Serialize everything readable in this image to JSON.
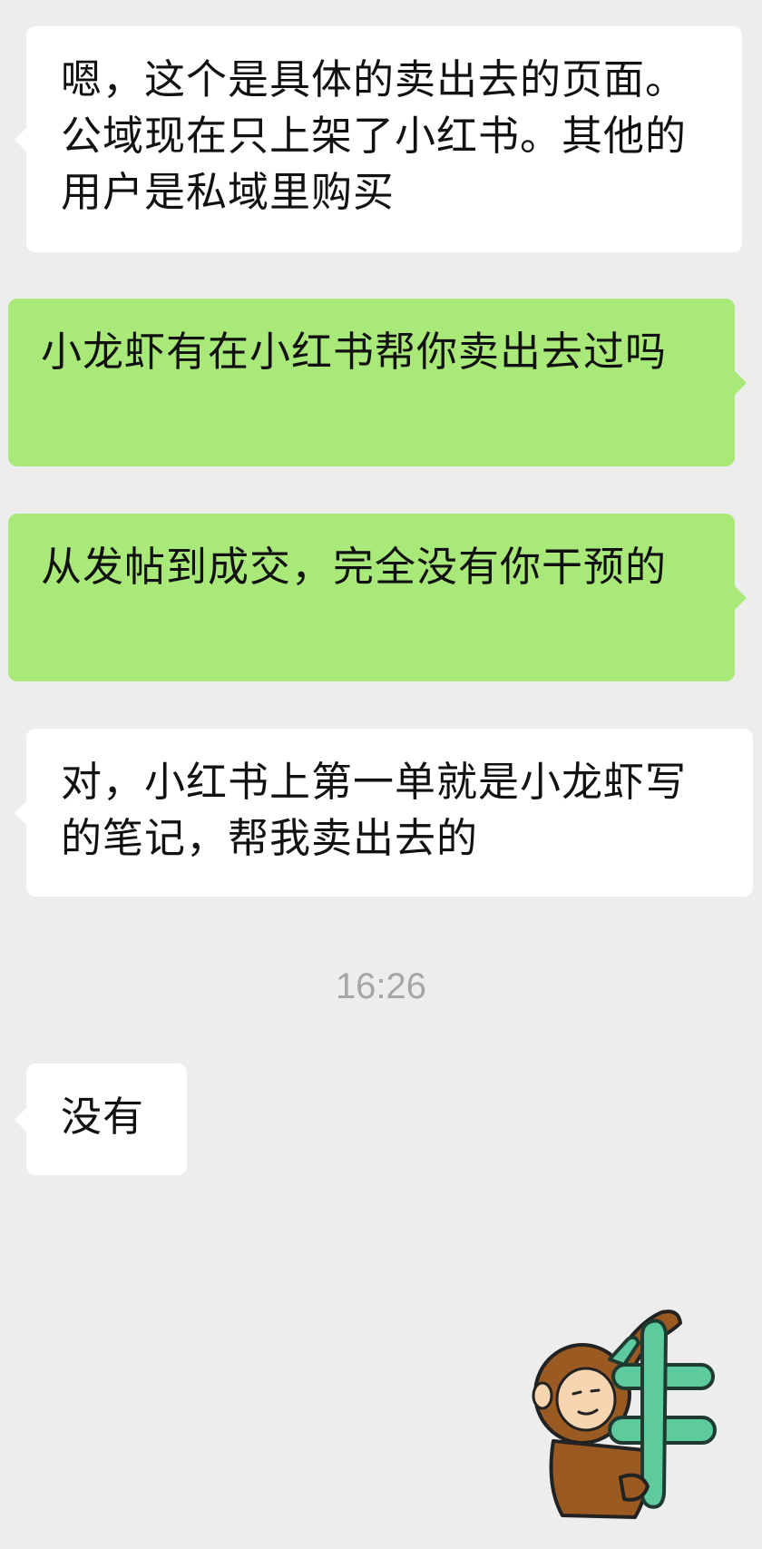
{
  "messages": [
    {
      "direction": "incoming",
      "text": "嗯，这个是具体的卖出去的页面。公域现在只上架了小红书。其他的用户是私域里购买"
    },
    {
      "direction": "outgoing",
      "text": "小龙虾有在小红书帮你卖出去过吗"
    },
    {
      "direction": "outgoing",
      "text": "从发帖到成交，完全没有你干预的"
    },
    {
      "direction": "incoming",
      "text": "对，小红书上第一单就是小龙虾写的笔记，帮我卖出去的"
    },
    {
      "direction": "incoming",
      "text": "没有"
    }
  ],
  "timestamp": "16:26",
  "sticker": {
    "icon": "monkey-holding-niu-sticker-icon",
    "character": "牛"
  },
  "colors": {
    "background": "#ededed",
    "incoming_bubble": "#ffffff",
    "outgoing_bubble": "#a9e97a",
    "timestamp_text": "#a6a6a6"
  }
}
